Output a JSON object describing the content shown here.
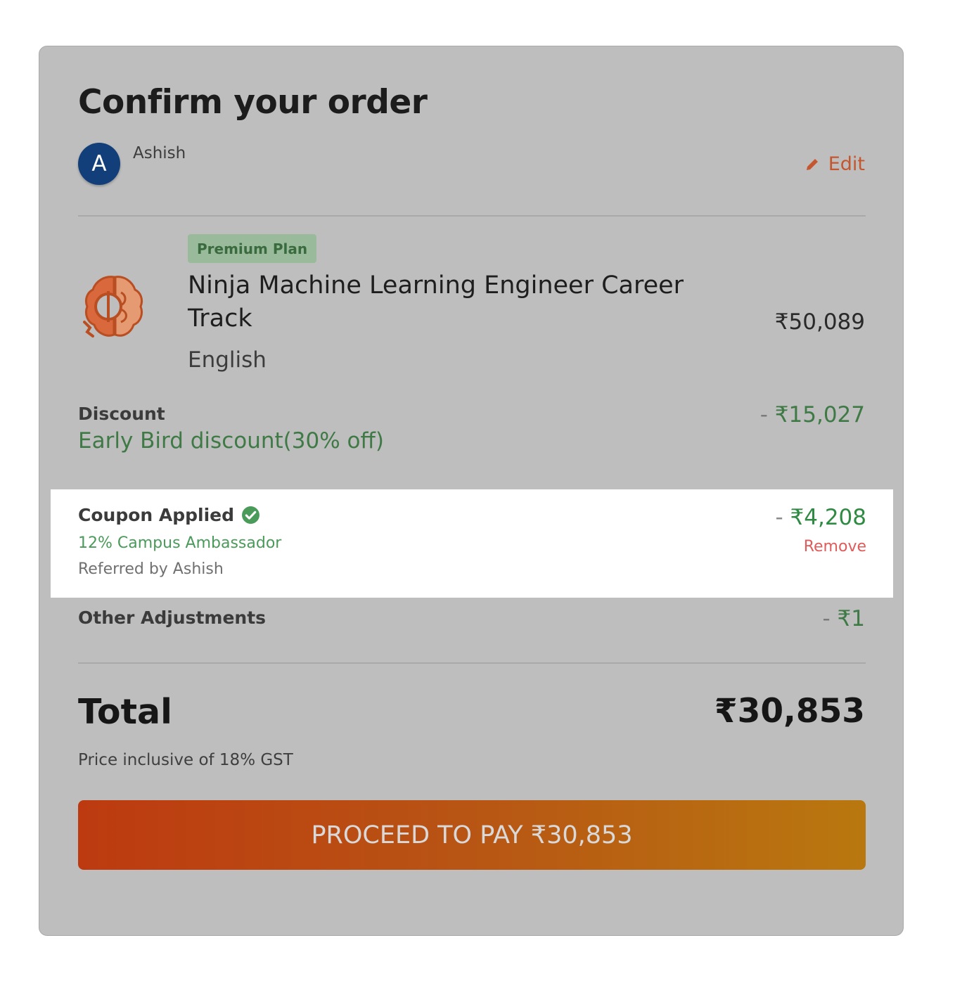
{
  "header": {
    "title": "Confirm your order",
    "user_initial": "A",
    "user_name": "Ashish",
    "edit_label": "Edit"
  },
  "course": {
    "badge": "Premium Plan",
    "title": "Ninja Machine Learning Engineer Career Track",
    "language": "English",
    "price": "₹50,089",
    "icon": "brain-gear-icon"
  },
  "discount": {
    "label": "Discount",
    "description": "Early Bird discount(30% off)",
    "amount_prefix": "- ",
    "amount": "₹15,027"
  },
  "coupon": {
    "label": "Coupon Applied",
    "name": "12% Campus Ambassador",
    "referred_by": "Referred by Ashish",
    "amount_prefix": "- ",
    "amount": "₹4,208",
    "remove_label": "Remove"
  },
  "other_adjustments": {
    "label": "Other Adjustments",
    "amount_prefix": "- ",
    "amount": "₹1"
  },
  "total": {
    "label": "Total",
    "amount": "₹30,853",
    "note": "Price inclusive of 18% GST"
  },
  "pay_button": {
    "label": "PROCEED TO PAY ₹30,853"
  },
  "colors": {
    "accent_orange": "#c4572f",
    "discount_green": "#3f7a46",
    "coupon_green": "#2f8a43",
    "remove_red": "#e05b5b",
    "avatar_blue": "#123f7a"
  }
}
